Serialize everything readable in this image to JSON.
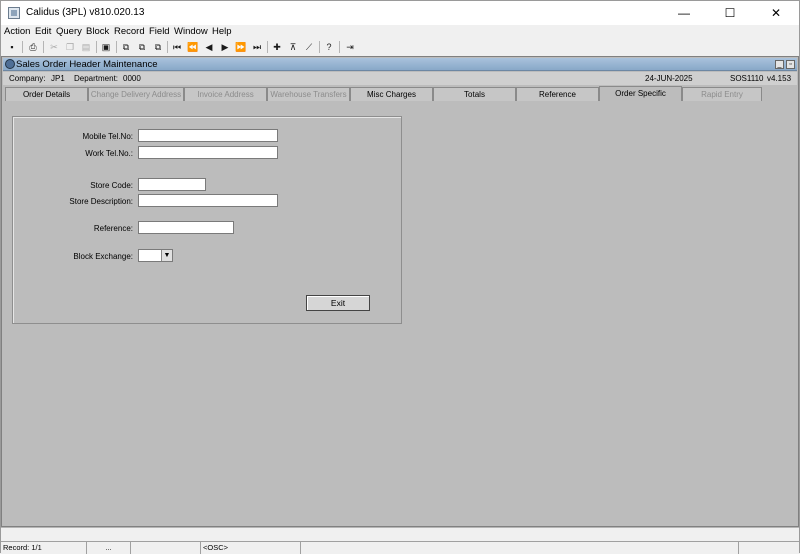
{
  "window": {
    "title": "Calidus (3PL) v810.020.13",
    "controls": {
      "minimize": "—",
      "maximize": "☐",
      "close": "✕"
    }
  },
  "menu": [
    "Action",
    "Edit",
    "Query",
    "Block",
    "Record",
    "Field",
    "Window",
    "Help"
  ],
  "toolbar_icons": [
    "save-icon",
    "print-icon",
    "cut-icon",
    "copy-icon",
    "paste-icon",
    "clear-icon",
    "query-icon",
    "query-execute-icon",
    "query-count-icon",
    "first-record-icon",
    "previous-page-icon",
    "previous-record-icon",
    "next-record-icon",
    "next-page-icon",
    "last-record-icon",
    "insert-record-icon",
    "delete-record-icon",
    "clear-record-icon",
    "help-icon",
    "exit-icon"
  ],
  "form": {
    "title": "Sales Order Header Maintenance",
    "company_label": "Company:",
    "company": "JP1",
    "department_label": "Department:",
    "department": "0000",
    "date": "24-JUN-2025",
    "form_code": "SOS1110",
    "version": "v4.153"
  },
  "tabs": [
    {
      "label": "Order Details",
      "state": "enabled"
    },
    {
      "label": "Change Delivery Address",
      "state": "disabled"
    },
    {
      "label": "Invoice Address",
      "state": "disabled"
    },
    {
      "label": "Warehouse Transfers",
      "state": "disabled"
    },
    {
      "label": "Misc Charges",
      "state": "enabled"
    },
    {
      "label": "Totals",
      "state": "enabled"
    },
    {
      "label": "Reference",
      "state": "enabled"
    },
    {
      "label": "Order Specific",
      "state": "active"
    },
    {
      "label": "Rapid Entry",
      "state": "disabled"
    }
  ],
  "fields": {
    "mobile_tel": {
      "label": "Mobile Tel.No:",
      "value": ""
    },
    "work_tel": {
      "label": "Work Tel.No.:",
      "value": ""
    },
    "store_code": {
      "label": "Store Code:",
      "value": ""
    },
    "store_description": {
      "label": "Store Description:",
      "value": ""
    },
    "reference": {
      "label": "Reference:",
      "value": ""
    },
    "block_exchange": {
      "label": "Block Exchange:",
      "value": ""
    }
  },
  "buttons": {
    "exit": "Exit"
  },
  "status": {
    "record": "Record: 1/1",
    "dots": "...",
    "mode": "<OSC>"
  }
}
